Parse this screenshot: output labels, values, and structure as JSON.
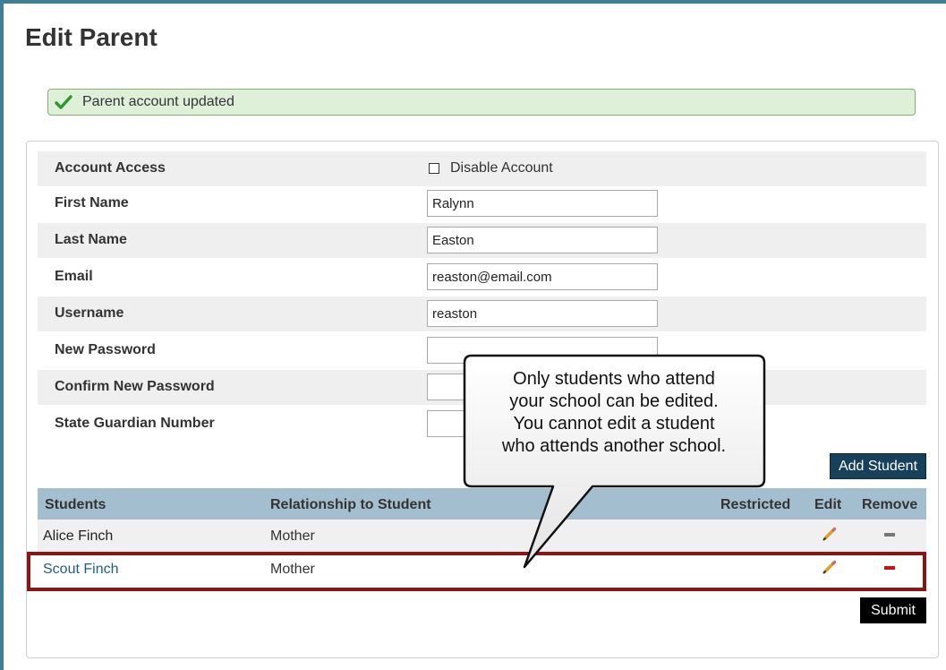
{
  "page": {
    "title": "Edit Parent"
  },
  "alert": {
    "message": "Parent account updated",
    "icon": "check-icon",
    "color": "#2a9a2a"
  },
  "form": {
    "account_access": {
      "label": "Account Access",
      "checkbox_label": "Disable Account",
      "checked": false
    },
    "first_name": {
      "label": "First Name",
      "value": "Ralynn"
    },
    "last_name": {
      "label": "Last Name",
      "value": "Easton"
    },
    "email": {
      "label": "Email",
      "value": "reaston@email.com"
    },
    "username": {
      "label": "Username",
      "value": "reaston"
    },
    "new_password": {
      "label": "New Password",
      "value": ""
    },
    "confirm_password": {
      "label": "Confirm New Password",
      "value": ""
    },
    "state_guardian_number": {
      "label": "State Guardian Number",
      "value": ""
    }
  },
  "buttons": {
    "add_student": "Add Student",
    "submit": "Submit"
  },
  "students": {
    "columns": [
      "Students",
      "Relationship to Student",
      "Restricted",
      "Edit",
      "Remove"
    ],
    "rows": [
      {
        "name": "Alice Finch",
        "relationship": "Mother",
        "remove_color": "#777777"
      },
      {
        "name": "Scout Finch",
        "relationship": "Mother",
        "remove_color": "#cc1111"
      }
    ]
  },
  "callout": {
    "lines": [
      "Only students who attend",
      "your school can be edited.",
      "You cannot edit a student",
      "who attends another school."
    ]
  },
  "colors": {
    "accent": "#3f7f93",
    "header_bg": "#a3bfcf",
    "highlight": "#8a1515",
    "button_dark": "#17415a"
  }
}
